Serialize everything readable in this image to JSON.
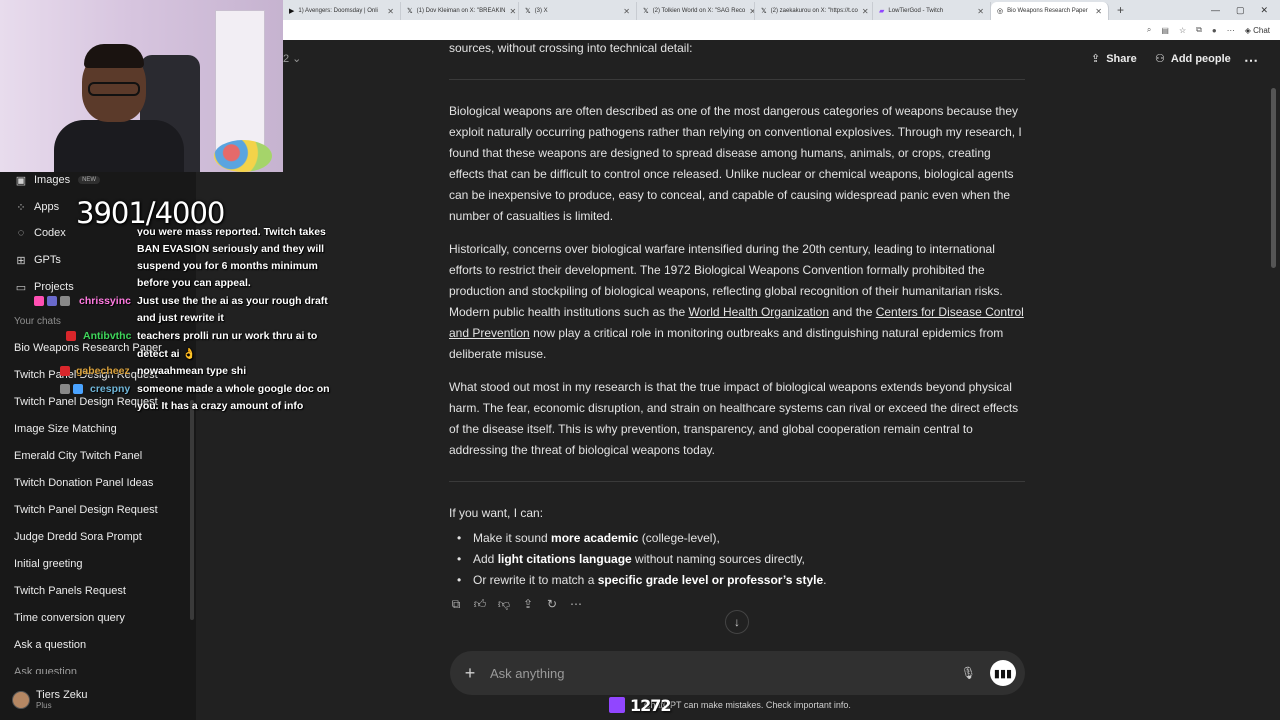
{
  "browser": {
    "tabs": [
      {
        "label": "1) Avengers: Doomsday | Onli",
        "fav": "▶"
      },
      {
        "label": "(1) Dov Kleiman on X: \"BREAKIN",
        "fav": "𝕏"
      },
      {
        "label": "(3) X",
        "fav": "𝕏"
      },
      {
        "label": "(2) Tolkien World on X: \"SAG Reco",
        "fav": "𝕏"
      },
      {
        "label": "(2) zaekakurou on X: \"https://t.co",
        "fav": "𝕏"
      },
      {
        "label": "LowTierGod - Twitch",
        "fav": "▰"
      },
      {
        "label": "Bio Weapons Research Paper",
        "fav": "◎"
      }
    ],
    "new_tab": "+",
    "copilot_label": "Chat"
  },
  "sidebar": {
    "nav": [
      {
        "label": "Images",
        "icon": "▣",
        "badge": "NEW"
      },
      {
        "label": "Apps",
        "icon": "⁘"
      },
      {
        "label": "Codex",
        "icon": "◌"
      },
      {
        "label": "GPTs",
        "icon": "⊞"
      },
      {
        "label": "Projects",
        "icon": "▭"
      }
    ],
    "section_label": "Your chats",
    "chats": [
      "Bio Weapons Research Paper",
      "Twitch Panel Design Request",
      "Twitch Panel Design Request",
      "Image Size Matching",
      "Emerald City Twitch Panel",
      "Twitch Donation Panel Ideas",
      "Twitch Panel Design Request",
      "Judge Dredd Sora Prompt",
      "Initial greeting",
      "Twitch Panels Request",
      "Time conversion query",
      "Ask a question",
      "Ask question"
    ],
    "user": {
      "name": "Tiers Zeku",
      "plan": "Plus"
    }
  },
  "overlay": {
    "counter": "3901/4000",
    "chat_lines": [
      "you were mass reported. Twitch takes",
      "BAN EVASION seriously and they will",
      "suspend you for 6 months minimum",
      "before you can appeal.",
      "Just use the the ai as your rough draft",
      "and just rewrite it",
      "teachers prolli run ur work thru ai to",
      "detect ai 👌",
      "nowaahmean type shi",
      "someone made a whole google doc on",
      "you. It has a crazy amount of info"
    ],
    "chat_users": [
      {
        "name": "chrissyinc",
        "color": "#ff7ae0"
      },
      {
        "name": "Antibvthc",
        "color": "#3fd65b"
      },
      {
        "name": "gabecheez",
        "color": "#d9a13c"
      },
      {
        "name": "crespny",
        "color": "#6fb6d9"
      }
    ],
    "viewers": "1272"
  },
  "header": {
    "model_chevron": "2 ⌄",
    "share_label": "Share",
    "add_people_label": "Add people",
    "more_icon": "⋯"
  },
  "message": {
    "intro": "sources, without crossing into technical detail:",
    "p1": "Biological weapons are often described as one of the most dangerous categories of weapons because they exploit naturally occurring pathogens rather than relying on conventional explosives. Through my research, I found that these weapons are designed to spread disease among humans, animals, or crops, creating effects that can be difficult to control once released. Unlike nuclear or chemical weapons, biological agents can be inexpensive to produce, easy to conceal, and capable of causing widespread panic even when the number of casualties is limited.",
    "p2_a": "Historically, concerns over biological warfare intensified during the 20th century, leading to international efforts to restrict their development. The 1972 Biological Weapons Convention formally prohibited the production and stockpiling of biological weapons, reflecting global recognition of their humanitarian risks. Modern public health institutions such as the ",
    "p2_link1": "World Health Organization",
    "p2_b": " and the ",
    "p2_link2": "Centers for Disease Control and Prevention",
    "p2_c": " now play a critical role in monitoring outbreaks and distinguishing natural epidemics from deliberate misuse.",
    "p3": "What stood out most in my research is that the true impact of biological weapons extends beyond physical harm. The fear, economic disruption, and strain on healthcare systems can rival or exceed the direct effects of the disease itself. This is why prevention, transparency, and global cooperation remain central to addressing the threat of biological weapons today.",
    "offer": "If you want, I can:",
    "bullets": [
      {
        "pre": "Make it sound ",
        "bold": "more academic",
        "post": " (college-level),"
      },
      {
        "pre": "Add ",
        "bold": "light citations language",
        "post": " without naming sources directly,"
      },
      {
        "pre": "Or rewrite it to match a ",
        "bold": "specific grade level or professor’s style",
        "post": "."
      }
    ]
  },
  "composer": {
    "placeholder": "Ask anything",
    "disclaimer": "ChatGPT can make mistakes. Check important info."
  }
}
